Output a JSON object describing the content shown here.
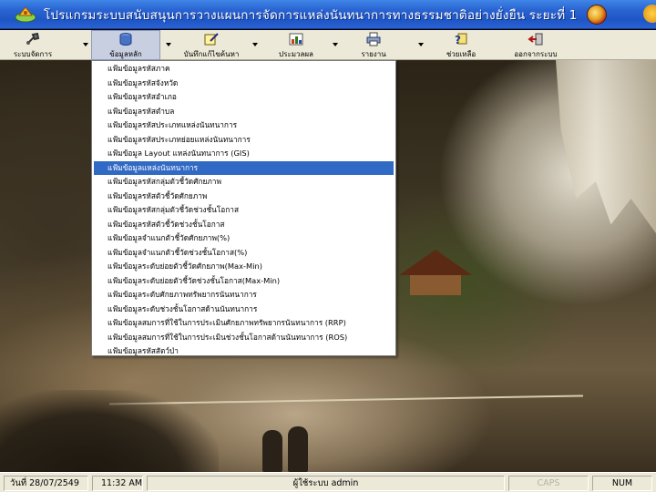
{
  "window": {
    "title": "โปรแกรมระบบสนับสนุนการวางแผนการจัดการแหล่งนันทนาการทางธรรมชาติอย่างยั่งยืน ระยะที่ 1"
  },
  "toolbar": {
    "items": [
      {
        "label": "ระบบจัดการ",
        "icon": "system-tools-icon"
      },
      {
        "label": "ข้อมูลหลัก",
        "icon": "database-icon"
      },
      {
        "label": "บันทึกแก้ไขค้นหา",
        "icon": "edit-search-icon"
      },
      {
        "label": "ประมวลผล",
        "icon": "process-chart-icon"
      },
      {
        "label": "รายงาน",
        "icon": "report-printer-icon"
      },
      {
        "label": "ช่วยเหลือ",
        "icon": "help-icon"
      },
      {
        "label": "ออกจากระบบ",
        "icon": "exit-icon"
      }
    ]
  },
  "menu": {
    "selected_index": 7,
    "items": [
      "แฟ้มข้อมูลรหัสภาค",
      "แฟ้มข้อมูลรหัสจังหวัด",
      "แฟ้มข้อมูลรหัสอำเภอ",
      "แฟ้มข้อมูลรหัสตำบล",
      "แฟ้มข้อมูลรหัสประเภทแหล่งนันทนาการ",
      "แฟ้มข้อมูลรหัสประเภทย่อยแหล่งนันทนาการ",
      "แฟ้มข้อมูล Layout แหล่งนันทนาการ (GIS)",
      "แฟ้มข้อมูลแหล่งนันทนาการ",
      "แฟ้มข้อมูลรหัสกลุ่มตัวชี้วัดศักยภาพ",
      "แฟ้มข้อมูลรหัสตัวชี้วัดศักยภาพ",
      "แฟ้มข้อมูลรหัสกลุ่มตัวชี้วัดช่วงชั้นโอกาส",
      "แฟ้มข้อมูลรหัสตัวชี้วัดช่วงชั้นโอกาส",
      "แฟ้มข้อมูลจำแนกตัวชี้วัดศักยภาพ(%)",
      "แฟ้มข้อมูลจำแนกตัวชี้วัดช่วงชั้นโอกาส(%)",
      "แฟ้มข้อมูลระดับย่อยตัวชี้วัดศักยภาพ(Max-Min)",
      "แฟ้มข้อมูลระดับย่อยตัวชี้วัดช่วงชั้นโอกาส(Max-Min)",
      "แฟ้มข้อมูลระดับศักยภาพทรัพยากรนันทนาการ",
      "แฟ้มข้อมูลระดับช่วงชั้นโอกาสด้านนันทนาการ",
      "แฟ้มข้อมูลสมการที่ใช้ในการประเมินศักยภาพทรัพยากรนันทนาการ (RRP)",
      "แฟ้มข้อมูลสมการที่ใช้ในการประเมินช่วงชั้นโอกาสด้านนันทนาการ (ROS)",
      "แฟ้มข้อมูลรหัสสัตว์ป่า"
    ]
  },
  "statusbar": {
    "date": "วันที่ 28/07/2549",
    "time": "11:32 AM",
    "user": "ผู้ใช้ระบบ admin",
    "caps": "CAPS",
    "num": "NUM"
  }
}
